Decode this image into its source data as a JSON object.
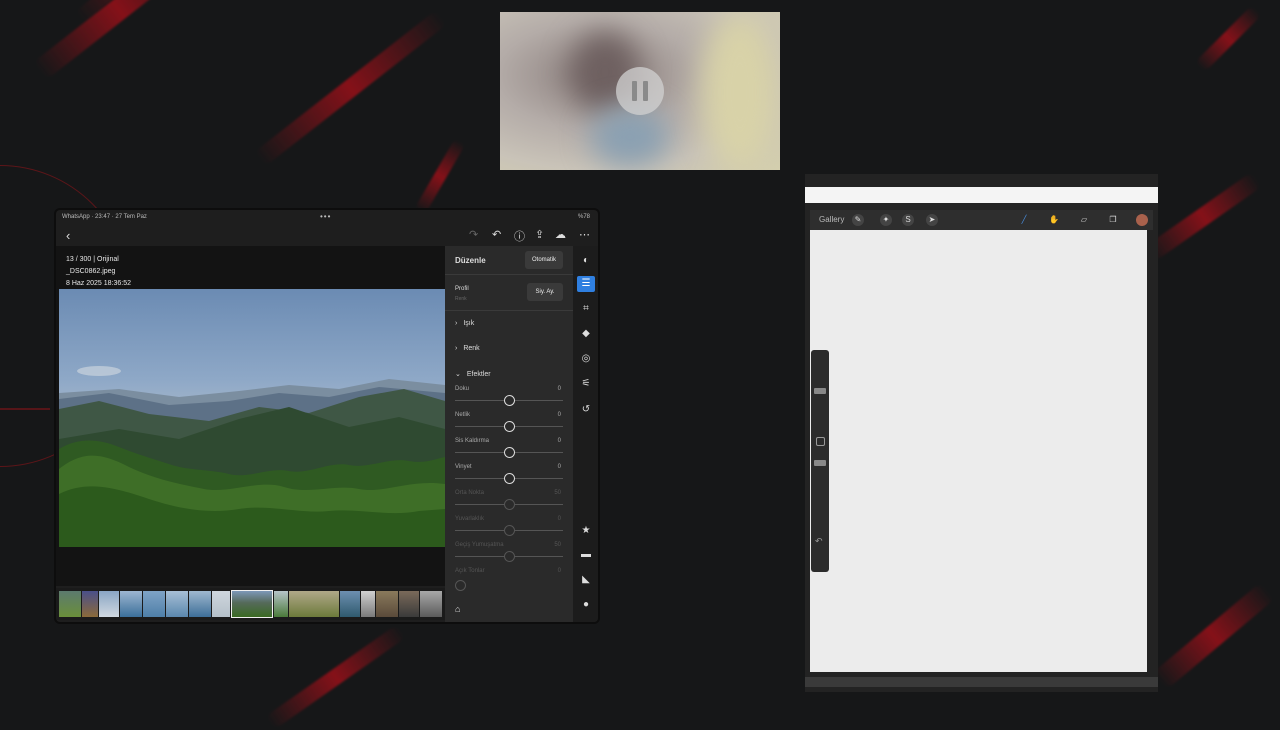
{
  "ipad": {
    "status": {
      "left": "WhatsApp · 23:47 · 27 Tem Paz",
      "dots": "•••",
      "right": "%78"
    },
    "photo_meta": {
      "line1": "13 / 300 | Orijinal",
      "line2": "_DSC0862.jpeg",
      "line3": "8 Haz 2025 18:36:52"
    },
    "panel": {
      "title": "Düzenle",
      "auto_button": "Otomatik",
      "profile_label": "Profil",
      "profile_value": "Renk",
      "bw_button": "Siy. Ay.",
      "sections": {
        "light": "Işık",
        "color": "Renk",
        "effects": "Efektler"
      },
      "sliders": [
        {
          "label": "Doku",
          "value": "0",
          "pos": 0.5,
          "enabled": true
        },
        {
          "label": "Netlik",
          "value": "0",
          "pos": 0.5,
          "enabled": true
        },
        {
          "label": "Sis Kaldırma",
          "value": "0",
          "pos": 0.5,
          "enabled": true
        },
        {
          "label": "Vinyet",
          "value": "0",
          "pos": 0.5,
          "enabled": true
        },
        {
          "label": "Orta Nokta",
          "value": "50",
          "pos": 0.5,
          "enabled": false
        },
        {
          "label": "Yuvarlaklık",
          "value": "0",
          "pos": 0.5,
          "enabled": false
        },
        {
          "label": "Geçiş Yumuşatma",
          "value": "50",
          "pos": 0.5,
          "enabled": false
        },
        {
          "label": "Açık Tonlar",
          "value": "0",
          "pos": 0.0,
          "enabled": false
        }
      ]
    }
  },
  "procreate": {
    "gallery_label": "Gallery"
  }
}
